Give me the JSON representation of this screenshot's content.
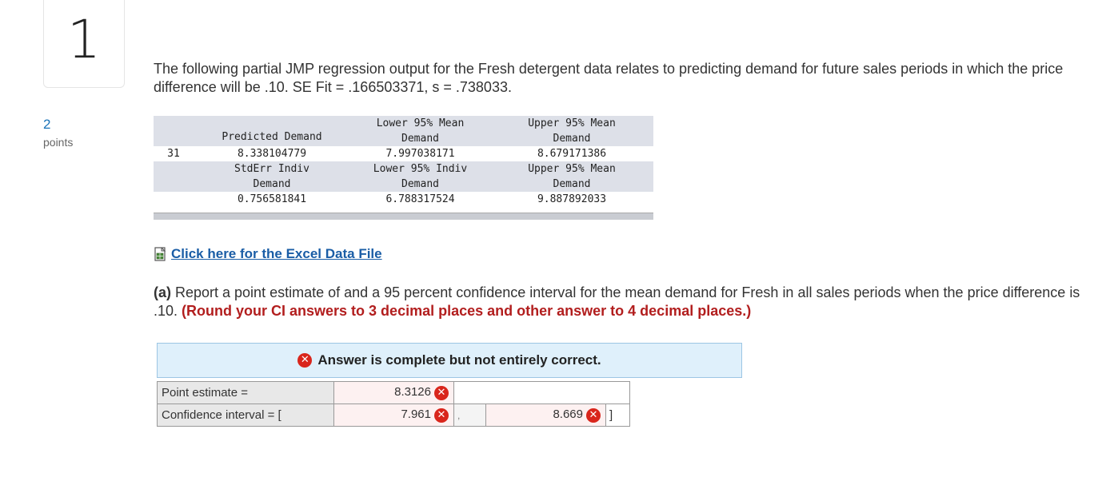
{
  "question_number": "1",
  "points": {
    "value": "2",
    "label": "points"
  },
  "question_text": "The following partial JMP regression output for the Fresh detergent data relates to predicting demand for future sales periods in which the price difference will be .10. SE Fit = .166503371, s = .738033.",
  "jmp_output": {
    "row_id": "31",
    "header1": {
      "predicted": "Predicted Demand",
      "lower_mean_1": "Lower 95% Mean",
      "lower_mean_2": "Demand",
      "upper_mean_1": "Upper 95% Mean",
      "upper_mean_2": "Demand"
    },
    "values1": {
      "predicted": "8.338104779",
      "lower_mean": "7.997038171",
      "upper_mean": "8.679171386"
    },
    "header2": {
      "stderr_1": "StdErr Indiv",
      "stderr_2": "Demand",
      "lower_indiv_1": "Lower 95% Indiv",
      "lower_indiv_2": "Demand",
      "upper_mean_1": "Upper 95% Mean",
      "upper_mean_2": "Demand"
    },
    "values2": {
      "stderr": "0.756581841",
      "lower_indiv": "6.788317524",
      "upper_mean": "9.887892033"
    }
  },
  "excel_link": "Click here for the Excel Data File",
  "part_a": {
    "label": "(a)",
    "text": " Report a point estimate of and a 95 percent confidence interval for the mean demand for Fresh in all sales periods when the price difference is .10. ",
    "instruction": "(Round your CI answers to 3 decimal places and other answer to 4 decimal places.)"
  },
  "answer_banner": "Answer is complete but not entirely correct.",
  "answers": {
    "point_estimate_label": "Point estimate =",
    "point_estimate_value": "8.3126",
    "ci_label": "Confidence interval = [",
    "ci_lower": "7.961",
    "ci_sep": ",",
    "ci_upper": "8.669",
    "ci_close": "]"
  },
  "colors": {
    "incorrect": "#d9261c",
    "link": "#1a5da6",
    "instruction": "#b21e1e",
    "banner_bg": "#dff0fb"
  }
}
